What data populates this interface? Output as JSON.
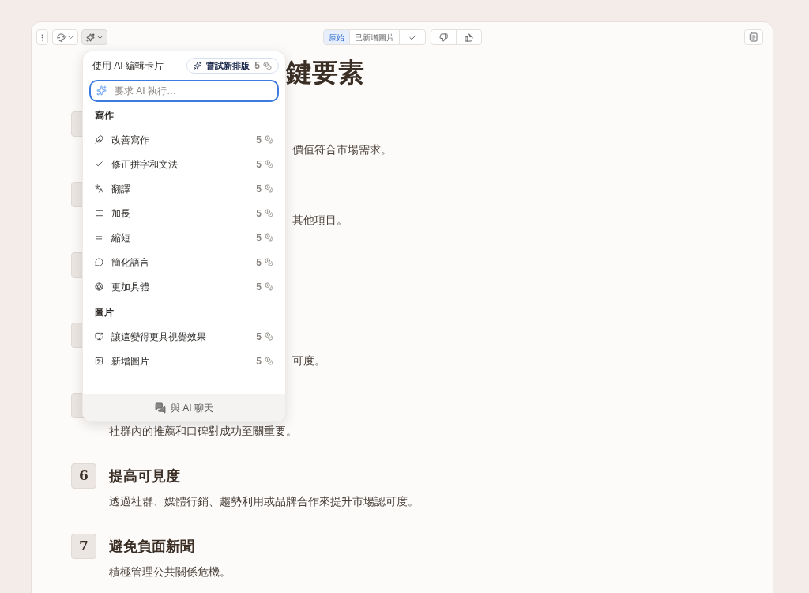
{
  "toolbar": {
    "tabs": [
      {
        "label": "原始",
        "selected": true
      },
      {
        "label": "已新增圖片",
        "selected": false
      }
    ]
  },
  "title": {
    "visible_end": "鍵要素"
  },
  "items": [
    {
      "kind": "covered",
      "text": "價值符合市場需求。"
    },
    {
      "kind": "covered",
      "text": "其他項目。"
    },
    {
      "kind": "covered"
    },
    {
      "kind": "covered",
      "text": "可度。"
    },
    {
      "kind": "covered_heading",
      "text": "社群內的推薦和口碑對成功至關重要。"
    },
    {
      "kind": "full",
      "number": "6",
      "heading": "提高可見度",
      "text": "透過社群、媒體行銷、趨勢利用或品牌合作來提升市場認可度。"
    },
    {
      "kind": "full",
      "number": "7",
      "heading": "避免負面新聞",
      "text": "積極管理公共關係危機。"
    }
  ],
  "ai_menu": {
    "title": "使用 AI 編輯卡片",
    "try_button": {
      "label": "嘗試新排版",
      "cost": "5"
    },
    "prompt": {
      "placeholder": "要求 AI 執行…"
    },
    "sections": [
      {
        "title": "寫作",
        "items": [
          {
            "kind": "feather",
            "label": "改善寫作",
            "cost": "5"
          },
          {
            "kind": "check",
            "label": "修正拼字和文法",
            "cost": "5"
          },
          {
            "kind": "translate",
            "label": "翻譯",
            "cost": "5"
          },
          {
            "kind": "lengthen",
            "label": "加長",
            "cost": "5"
          },
          {
            "kind": "shorten",
            "label": "縮短",
            "cost": "5"
          },
          {
            "kind": "simplify",
            "label": "簡化語言",
            "cost": "5"
          },
          {
            "kind": "specific",
            "label": "更加具體",
            "cost": "5"
          }
        ]
      },
      {
        "title": "圖片",
        "items": [
          {
            "kind": "visual",
            "label": "讓這變得更具視覺效果",
            "cost": "5"
          },
          {
            "kind": "image",
            "label": "新增圖片",
            "cost": "5"
          }
        ]
      }
    ],
    "chat_button": "與 AI 聊天"
  }
}
